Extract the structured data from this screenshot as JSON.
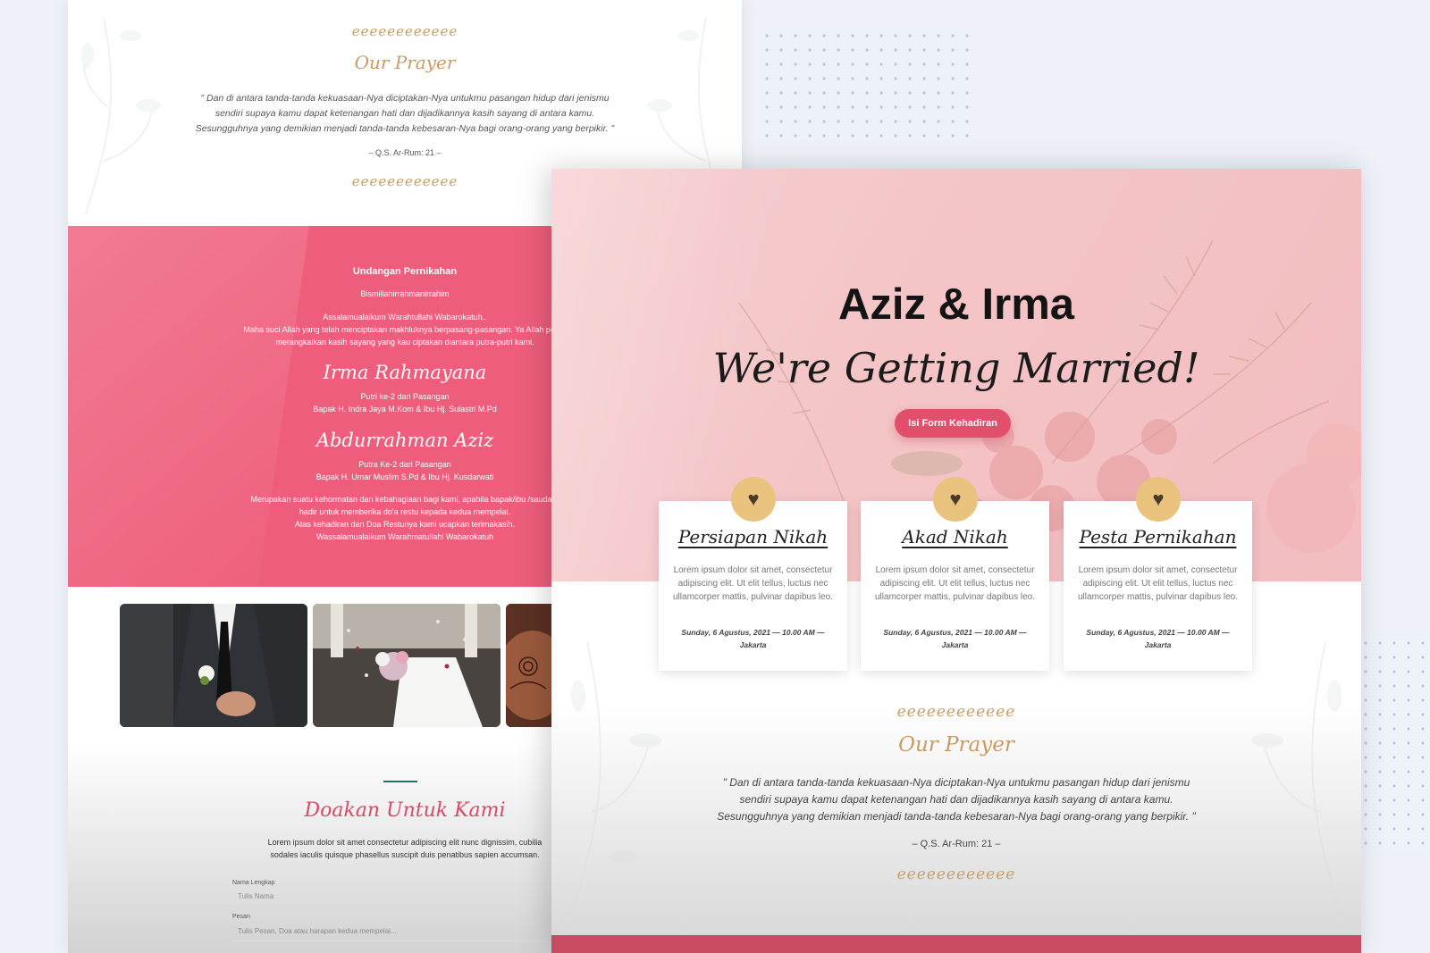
{
  "back_page": {
    "prayer": {
      "divider": "ℯℯℯℯℯℯℯℯℯℯℯℯ",
      "title": "Our Prayer",
      "verse_1": "\" Dan di antara tanda-tanda kekuasaan-Nya diciptakan-Nya untukmu pasangan hidup dari jenismu",
      "verse_2": "sendiri supaya kamu dapat ketenangan hati dan dijadikannya kasih sayang di antara kamu.",
      "verse_3": "Sesungguhnya yang demikian menjadi tanda-tanda kebesaran-Nya bagi orang-orang yang berpikir. \"",
      "source": "– Q.S. Ar-Rum: 21 –"
    },
    "invitation": {
      "heading": "Undangan Pernikahan",
      "bismillah": "Bismillahirrahmanirrahim",
      "greeting": "Assalamualaikum Warahtullahi Wabarokatuh..",
      "intro_1": "Maha suci Allah yang telah menciptakan makhluknya berpasang-pasangan. Ya Allah perke",
      "intro_2": "merangkaikan kasih sayang yang kau ciptakan diantara putra-putri kami.",
      "bride_name": "Irma Rahmayana",
      "bride_order": "Putri ke-2 dari Pasangan",
      "bride_parents": "Bapak H. Indra Jaya M.Kom & Ibu Hj. Sulastri M.Pd",
      "groom_name": "Abdurrahman Aziz",
      "groom_order": "Putra Ke-2 dari Pasangan",
      "groom_parents": "Bapak H. Umar Muslim S.Pd & Ibu Hj. Kusdarwati",
      "closing_1": "Merupakan suatu kehormatan dan kebahagiaan bagi kami, apabila bapak/ibu /saudara",
      "closing_2": "hadir untuk memberika do'a restu kepada kedua mempelai.",
      "closing_3": "Atas kehadiran dan Doa Restunya kami ucapkan terimakasih.",
      "closing_4": "Wassalamualaikum Warahmatullahi Wabarokatuh"
    },
    "prayer_form": {
      "title": "Doakan Untuk Kami",
      "desc_1": "Lorem ipsum dolor sit amet consectetur adipiscing elit nunc dignissim, cubilia",
      "desc_2": "sodales iaculis quisque phasellus suscipit duis penatibus sapien accumsan.",
      "name_label": "Nama Lengkap",
      "name_placeholder": "Tulis Nama",
      "message_label": "Pesan",
      "message_placeholder": "Tulis Pesan, Doa atau harapan kedua mempelai..."
    }
  },
  "front_page": {
    "couple": "Aziz & Irma",
    "tagline": "We're Getting Married!",
    "cta_label": "Isi Form Kehadiran",
    "events": [
      {
        "title": "Persiapan Nikah",
        "body": "Lorem ipsum dolor sit amet, consectetur adipiscing elit. Ut elit tellus, luctus nec ullamcorper mattis, pulvinar dapibus leo.",
        "date_1": "Sunday, 6 Agustus, 2021 — 10.00 AM —",
        "date_2": "Jakarta"
      },
      {
        "title": "Akad Nikah",
        "body": "Lorem ipsum dolor sit amet, consectetur adipiscing elit. Ut elit tellus, luctus nec ullamcorper mattis, pulvinar dapibus leo.",
        "date_1": "Sunday, 6 Agustus, 2021 — 10.00 AM —",
        "date_2": "Jakarta"
      },
      {
        "title": "Pesta Pernikahan",
        "body": "Lorem ipsum dolor sit amet, consectetur adipiscing elit. Ut elit tellus, luctus nec ullamcorper mattis, pulvinar dapibus leo.",
        "date_1": "Sunday, 6 Agustus, 2021 — 10.00 AM —",
        "date_2": "Jakarta"
      }
    ],
    "prayer": {
      "divider": "ℯℯℯℯℯℯℯℯℯℯℯℯ",
      "title": "Our Prayer",
      "verse_1": "\" Dan di antara tanda-tanda kekuasaan-Nya diciptakan-Nya untukmu pasangan hidup dari jenismu",
      "verse_2": "sendiri supaya kamu dapat ketenangan hati dan dijadikannya kasih sayang di antara kamu.",
      "verse_3": "Sesungguhnya yang demikian menjadi tanda-tanda kebesaran-Nya bagi orang-orang yang berpikir. \"",
      "source": "– Q.S. Ar-Rum: 21 –"
    }
  },
  "icons": {
    "heart": "heart-icon"
  },
  "colors": {
    "pink": "#ee5e7c",
    "gold": "#c6a06a",
    "badge": "#e9c27d",
    "cta": "#e24f6d",
    "accent_line": "#2b6d6a"
  }
}
